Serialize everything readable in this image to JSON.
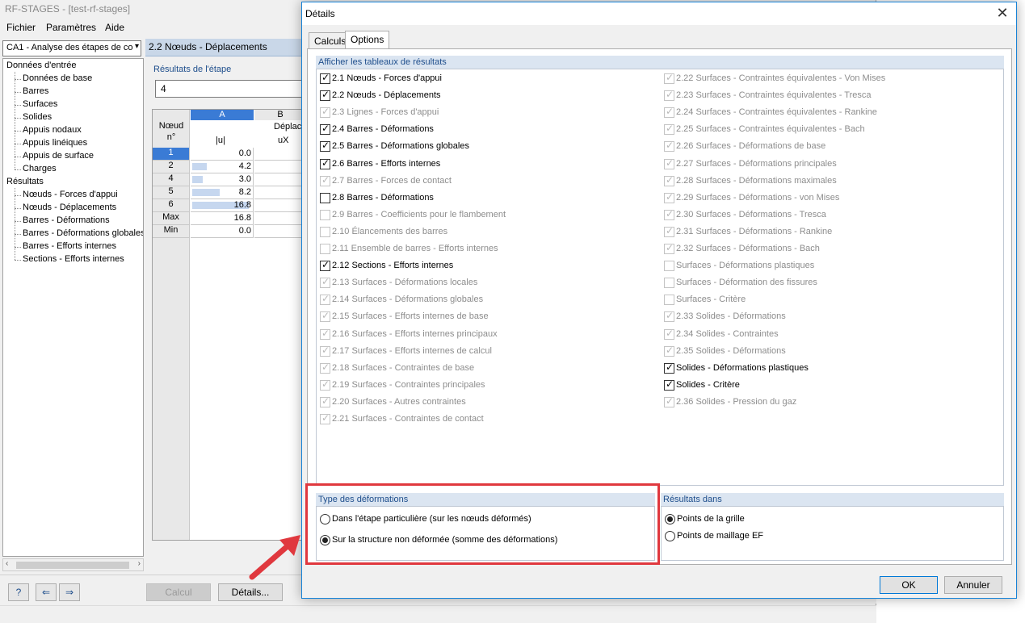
{
  "main": {
    "title": "RF-STAGES - [test-rf-stages]",
    "menu": [
      "Fichier",
      "Paramètres",
      "Aide"
    ],
    "case_select": "CA1 - Analyse des étapes de co",
    "tree": {
      "input_root": "Données d'entrée",
      "input_items": [
        "Données de base",
        "Barres",
        "Surfaces",
        "Solides",
        "Appuis nodaux",
        "Appuis linéiques",
        "Appuis de surface",
        "Charges"
      ],
      "results_root": "Résultats",
      "result_items": [
        "Nœuds - Forces d'appui",
        "Nœuds - Déplacements",
        "Barres - Déformations",
        "Barres - Déformations globales",
        "Barres - Efforts internes",
        "Sections - Efforts internes"
      ]
    },
    "panel_title": "2.2 Nœuds - Déplacements",
    "stage_label": "Résultats de l'étape",
    "stage_value": "4",
    "grid": {
      "col_a": "A",
      "col_b": "B",
      "row_head_1": "Nœud",
      "row_head_2": "n°",
      "group_b": "Déplac",
      "sub_a": "|u|",
      "sub_b": "uX",
      "rows": [
        {
          "label": "1",
          "value": "0.0",
          "fraction": 0.0,
          "selected": true
        },
        {
          "label": "2",
          "value": "4.2",
          "fraction": 0.25
        },
        {
          "label": "4",
          "value": "3.0",
          "fraction": 0.18
        },
        {
          "label": "5",
          "value": "8.2",
          "fraction": 0.49
        },
        {
          "label": "6",
          "value": "16.8",
          "fraction": 1.0
        },
        {
          "label": "Max",
          "value": "16.8",
          "fraction": 0
        },
        {
          "label": "Min",
          "value": "0.0",
          "fraction": 0
        }
      ],
      "col_b_glyph": "("
    },
    "buttons": {
      "calc": "Calcul",
      "details": "Détails..."
    }
  },
  "dialog": {
    "title": "Détails",
    "close": "✕",
    "tabs": [
      "Calculs",
      "Options"
    ],
    "tables_group": "Afficher les tableaux de résultats",
    "left_column": [
      {
        "label": "2.1 Nœuds - Forces d'appui",
        "checked": true,
        "enabled": true
      },
      {
        "label": "2.2 Nœuds - Déplacements",
        "checked": true,
        "enabled": true
      },
      {
        "label": "2.3 Lignes - Forces d'appui",
        "checked": true,
        "enabled": false
      },
      {
        "label": "2.4 Barres - Déformations",
        "checked": true,
        "enabled": true
      },
      {
        "label": "2.5 Barres - Déformations globales",
        "checked": true,
        "enabled": true
      },
      {
        "label": "2.6 Barres - Efforts internes",
        "checked": true,
        "enabled": true
      },
      {
        "label": "2.7 Barres - Forces de contact",
        "checked": true,
        "enabled": false
      },
      {
        "label": "2.8 Barres - Déformations",
        "checked": false,
        "enabled": true
      },
      {
        "label": "2.9 Barres - Coefficients pour le flambement",
        "checked": false,
        "enabled": false
      },
      {
        "label": "2.10 Élancements des barres",
        "checked": false,
        "enabled": false
      },
      {
        "label": "2.11 Ensemble de barres - Efforts internes",
        "checked": false,
        "enabled": false
      },
      {
        "label": "2.12 Sections - Efforts internes",
        "checked": true,
        "enabled": true
      },
      {
        "label": "2.13 Surfaces - Déformations locales",
        "checked": true,
        "enabled": false
      },
      {
        "label": "2.14 Surfaces - Déformations globales",
        "checked": true,
        "enabled": false
      },
      {
        "label": "2.15 Surfaces - Efforts internes de base",
        "checked": true,
        "enabled": false
      },
      {
        "label": "2.16 Surfaces - Efforts internes principaux",
        "checked": true,
        "enabled": false
      },
      {
        "label": "2.17 Surfaces - Efforts internes de calcul",
        "checked": true,
        "enabled": false
      },
      {
        "label": "2.18 Surfaces - Contraintes de base",
        "checked": true,
        "enabled": false
      },
      {
        "label": "2.19 Surfaces - Contraintes principales",
        "checked": true,
        "enabled": false
      },
      {
        "label": "2.20 Surfaces - Autres contraintes",
        "checked": true,
        "enabled": false
      },
      {
        "label": "2.21 Surfaces - Contraintes de contact",
        "checked": true,
        "enabled": false
      }
    ],
    "right_column": [
      {
        "label": "2.22 Surfaces - Contraintes équivalentes - Von Mises",
        "checked": true,
        "enabled": false
      },
      {
        "label": "2.23 Surfaces - Contraintes équivalentes - Tresca",
        "checked": true,
        "enabled": false
      },
      {
        "label": "2.24 Surfaces - Contraintes équivalentes - Rankine",
        "checked": true,
        "enabled": false
      },
      {
        "label": "2.25 Surfaces - Contraintes équivalentes - Bach",
        "checked": true,
        "enabled": false
      },
      {
        "label": "2.26 Surfaces - Déformations de base",
        "checked": true,
        "enabled": false
      },
      {
        "label": "2.27 Surfaces - Déformations principales",
        "checked": true,
        "enabled": false
      },
      {
        "label": "2.28 Surfaces - Déformations maximales",
        "checked": true,
        "enabled": false
      },
      {
        "label": "2.29 Surfaces - Déformations - von Mises",
        "checked": true,
        "enabled": false
      },
      {
        "label": "2.30 Surfaces - Déformations - Tresca",
        "checked": true,
        "enabled": false
      },
      {
        "label": "2.31 Surfaces - Déformations - Rankine",
        "checked": true,
        "enabled": false
      },
      {
        "label": "2.32 Surfaces - Déformations - Bach",
        "checked": true,
        "enabled": false
      },
      {
        "label": "Surfaces - Déformations plastiques",
        "checked": false,
        "enabled": false
      },
      {
        "label": "Surfaces - Déformation des fissures",
        "checked": false,
        "enabled": false
      },
      {
        "label": "Surfaces - Critère",
        "checked": false,
        "enabled": false
      },
      {
        "label": "2.33 Solides - Déformations",
        "checked": true,
        "enabled": false
      },
      {
        "label": "2.34 Solides - Contraintes",
        "checked": true,
        "enabled": false
      },
      {
        "label": "2.35 Solides - Déformations",
        "checked": true,
        "enabled": false
      },
      {
        "label": "Solides - Déformations plastiques",
        "checked": true,
        "enabled": true
      },
      {
        "label": "Solides - Critère",
        "checked": true,
        "enabled": true
      },
      {
        "label": "2.36 Solides - Pression du gaz",
        "checked": true,
        "enabled": false
      }
    ],
    "deformation_group": "Type des déformations",
    "deformation_options": [
      {
        "label": "Dans l'étape particulière (sur les nœuds déformés)",
        "selected": false
      },
      {
        "label": "Sur la structure non déformée (somme des déformations)",
        "selected": true
      }
    ],
    "results_in_group": "Résultats dans",
    "results_in_options": [
      {
        "label": "Points de la grille",
        "selected": true
      },
      {
        "label": "Points de maillage EF",
        "selected": false
      }
    ],
    "ok": "OK",
    "cancel": "Annuler"
  },
  "colors": {
    "highlight": "#e0383e",
    "accent": "#1e4e8c",
    "selected_cell": "#3a7bd5"
  }
}
